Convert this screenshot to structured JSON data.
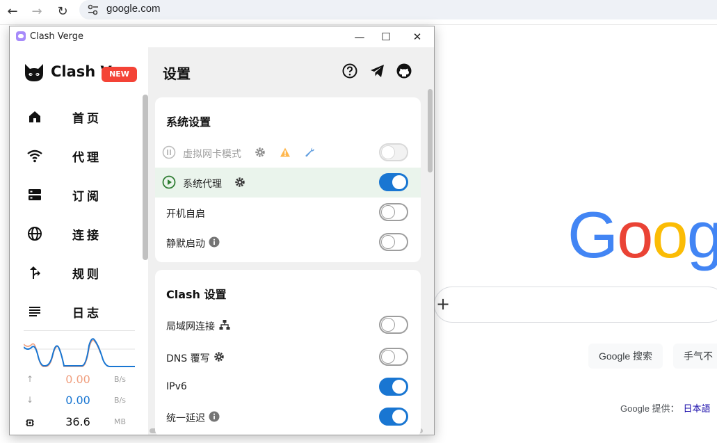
{
  "browser": {
    "url": "google.com",
    "logo_letters": [
      "G",
      "o",
      "o",
      "g"
    ],
    "search_button": "Google 搜索",
    "lucky_button": "手气不",
    "offered_in": "Google 提供：",
    "language_link": "日本語"
  },
  "window": {
    "title": "Clash Verge",
    "minimize": "—",
    "maximize": "☐",
    "close": "✕"
  },
  "sidebar": {
    "brand": "Clash V",
    "badge": "NEW",
    "items": [
      {
        "label": "首页",
        "icon": "home-icon"
      },
      {
        "label": "代理",
        "icon": "wifi-icon"
      },
      {
        "label": "订阅",
        "icon": "storage-icon"
      },
      {
        "label": "连接",
        "icon": "globe-icon"
      },
      {
        "label": "规则",
        "icon": "fork-icon"
      },
      {
        "label": "日志",
        "icon": "list-icon"
      }
    ],
    "traffic": {
      "upload": {
        "value": "0.00",
        "unit": "B/s",
        "color": "#f0a080"
      },
      "download": {
        "value": "0.00",
        "unit": "B/s",
        "color": "#1976d2"
      },
      "memory": {
        "value": "36.6",
        "unit": "MB",
        "color": "#111111"
      }
    }
  },
  "main": {
    "title": "设置",
    "system_card": {
      "title": "系统设置",
      "rows": [
        {
          "label": "虚拟网卡模式",
          "enabled": false,
          "disabled": true
        },
        {
          "label": "系统代理",
          "enabled": true
        },
        {
          "label": "开机自启",
          "enabled": false
        },
        {
          "label": "静默启动",
          "enabled": false
        }
      ]
    },
    "clash_card": {
      "title": "Clash 设置",
      "rows": [
        {
          "label": "局域网连接",
          "enabled": false
        },
        {
          "label": "DNS 覆写",
          "enabled": false
        },
        {
          "label": "IPv6",
          "enabled": true
        },
        {
          "label": "统一延迟",
          "enabled": true
        }
      ]
    }
  },
  "colors": {
    "accent": "#1976d2",
    "badge": "#f44336",
    "active_row": "#eaf4ec",
    "play_green": "#2e7d32",
    "warning": "#ffb74d"
  }
}
